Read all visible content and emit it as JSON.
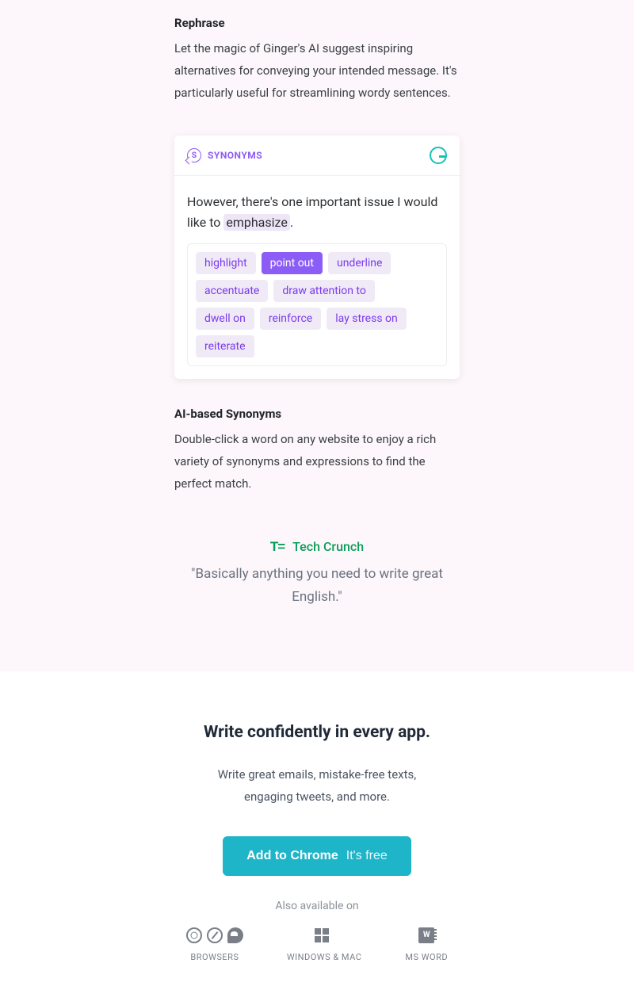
{
  "rephrase": {
    "title": "Rephrase",
    "desc": "Let the magic of Ginger's AI suggest inspiring alternatives for conveying your intended message. It's particularly useful for streamlining wordy sentences."
  },
  "synonyms_card": {
    "badge_letter": "S",
    "label": "SYNONYMS",
    "text_before": "However, there's one important issue I would like to ",
    "highlighted_word": "emphasize",
    "text_after": ".",
    "chips": [
      {
        "label": "highlight",
        "active": false
      },
      {
        "label": "point out",
        "active": true
      },
      {
        "label": "underline",
        "active": false
      },
      {
        "label": "accentuate",
        "active": false
      },
      {
        "label": "draw attention to",
        "active": false
      },
      {
        "label": "dwell on",
        "active": false
      },
      {
        "label": "reinforce",
        "active": false
      },
      {
        "label": "lay stress on",
        "active": false
      },
      {
        "label": "reiterate",
        "active": false
      }
    ]
  },
  "ai_synonyms": {
    "title": "AI-based Synonyms",
    "desc": "Double-click a word on any website to enjoy a rich variety of synonyms and expressions to find the perfect match."
  },
  "quote": {
    "logo_text": "T=",
    "source": "Tech Crunch",
    "text": "\"Basically anything you need to write great English.\""
  },
  "cta": {
    "title": "Write confidently in every app.",
    "desc": "Write great emails, mistake-free texts, engaging tweets, and more.",
    "button_main": "Add to Chrome",
    "button_sub": "It's free",
    "also_label": "Also available on",
    "platforms": [
      {
        "label": "BROWSERS"
      },
      {
        "label": "WINDOWS & MAC"
      },
      {
        "label": "MS WORD"
      }
    ]
  }
}
